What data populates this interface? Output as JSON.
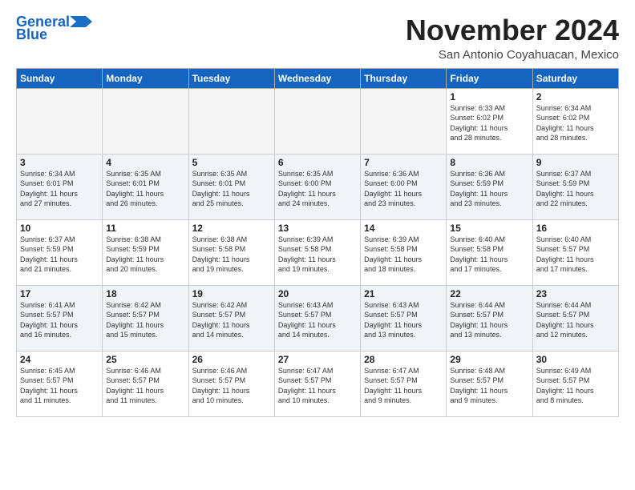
{
  "logo": {
    "line1": "General",
    "line2": "Blue"
  },
  "title": "November 2024",
  "location": "San Antonio Coyahuacan, Mexico",
  "weekdays": [
    "Sunday",
    "Monday",
    "Tuesday",
    "Wednesday",
    "Thursday",
    "Friday",
    "Saturday"
  ],
  "weeks": [
    [
      {
        "day": "",
        "info": ""
      },
      {
        "day": "",
        "info": ""
      },
      {
        "day": "",
        "info": ""
      },
      {
        "day": "",
        "info": ""
      },
      {
        "day": "",
        "info": ""
      },
      {
        "day": "1",
        "info": "Sunrise: 6:33 AM\nSunset: 6:02 PM\nDaylight: 11 hours\nand 28 minutes."
      },
      {
        "day": "2",
        "info": "Sunrise: 6:34 AM\nSunset: 6:02 PM\nDaylight: 11 hours\nand 28 minutes."
      }
    ],
    [
      {
        "day": "3",
        "info": "Sunrise: 6:34 AM\nSunset: 6:01 PM\nDaylight: 11 hours\nand 27 minutes."
      },
      {
        "day": "4",
        "info": "Sunrise: 6:35 AM\nSunset: 6:01 PM\nDaylight: 11 hours\nand 26 minutes."
      },
      {
        "day": "5",
        "info": "Sunrise: 6:35 AM\nSunset: 6:01 PM\nDaylight: 11 hours\nand 25 minutes."
      },
      {
        "day": "6",
        "info": "Sunrise: 6:35 AM\nSunset: 6:00 PM\nDaylight: 11 hours\nand 24 minutes."
      },
      {
        "day": "7",
        "info": "Sunrise: 6:36 AM\nSunset: 6:00 PM\nDaylight: 11 hours\nand 23 minutes."
      },
      {
        "day": "8",
        "info": "Sunrise: 6:36 AM\nSunset: 5:59 PM\nDaylight: 11 hours\nand 23 minutes."
      },
      {
        "day": "9",
        "info": "Sunrise: 6:37 AM\nSunset: 5:59 PM\nDaylight: 11 hours\nand 22 minutes."
      }
    ],
    [
      {
        "day": "10",
        "info": "Sunrise: 6:37 AM\nSunset: 5:59 PM\nDaylight: 11 hours\nand 21 minutes."
      },
      {
        "day": "11",
        "info": "Sunrise: 6:38 AM\nSunset: 5:59 PM\nDaylight: 11 hours\nand 20 minutes."
      },
      {
        "day": "12",
        "info": "Sunrise: 6:38 AM\nSunset: 5:58 PM\nDaylight: 11 hours\nand 19 minutes."
      },
      {
        "day": "13",
        "info": "Sunrise: 6:39 AM\nSunset: 5:58 PM\nDaylight: 11 hours\nand 19 minutes."
      },
      {
        "day": "14",
        "info": "Sunrise: 6:39 AM\nSunset: 5:58 PM\nDaylight: 11 hours\nand 18 minutes."
      },
      {
        "day": "15",
        "info": "Sunrise: 6:40 AM\nSunset: 5:58 PM\nDaylight: 11 hours\nand 17 minutes."
      },
      {
        "day": "16",
        "info": "Sunrise: 6:40 AM\nSunset: 5:57 PM\nDaylight: 11 hours\nand 17 minutes."
      }
    ],
    [
      {
        "day": "17",
        "info": "Sunrise: 6:41 AM\nSunset: 5:57 PM\nDaylight: 11 hours\nand 16 minutes."
      },
      {
        "day": "18",
        "info": "Sunrise: 6:42 AM\nSunset: 5:57 PM\nDaylight: 11 hours\nand 15 minutes."
      },
      {
        "day": "19",
        "info": "Sunrise: 6:42 AM\nSunset: 5:57 PM\nDaylight: 11 hours\nand 14 minutes."
      },
      {
        "day": "20",
        "info": "Sunrise: 6:43 AM\nSunset: 5:57 PM\nDaylight: 11 hours\nand 14 minutes."
      },
      {
        "day": "21",
        "info": "Sunrise: 6:43 AM\nSunset: 5:57 PM\nDaylight: 11 hours\nand 13 minutes."
      },
      {
        "day": "22",
        "info": "Sunrise: 6:44 AM\nSunset: 5:57 PM\nDaylight: 11 hours\nand 13 minutes."
      },
      {
        "day": "23",
        "info": "Sunrise: 6:44 AM\nSunset: 5:57 PM\nDaylight: 11 hours\nand 12 minutes."
      }
    ],
    [
      {
        "day": "24",
        "info": "Sunrise: 6:45 AM\nSunset: 5:57 PM\nDaylight: 11 hours\nand 11 minutes."
      },
      {
        "day": "25",
        "info": "Sunrise: 6:46 AM\nSunset: 5:57 PM\nDaylight: 11 hours\nand 11 minutes."
      },
      {
        "day": "26",
        "info": "Sunrise: 6:46 AM\nSunset: 5:57 PM\nDaylight: 11 hours\nand 10 minutes."
      },
      {
        "day": "27",
        "info": "Sunrise: 6:47 AM\nSunset: 5:57 PM\nDaylight: 11 hours\nand 10 minutes."
      },
      {
        "day": "28",
        "info": "Sunrise: 6:47 AM\nSunset: 5:57 PM\nDaylight: 11 hours\nand 9 minutes."
      },
      {
        "day": "29",
        "info": "Sunrise: 6:48 AM\nSunset: 5:57 PM\nDaylight: 11 hours\nand 9 minutes."
      },
      {
        "day": "30",
        "info": "Sunrise: 6:49 AM\nSunset: 5:57 PM\nDaylight: 11 hours\nand 8 minutes."
      }
    ]
  ]
}
